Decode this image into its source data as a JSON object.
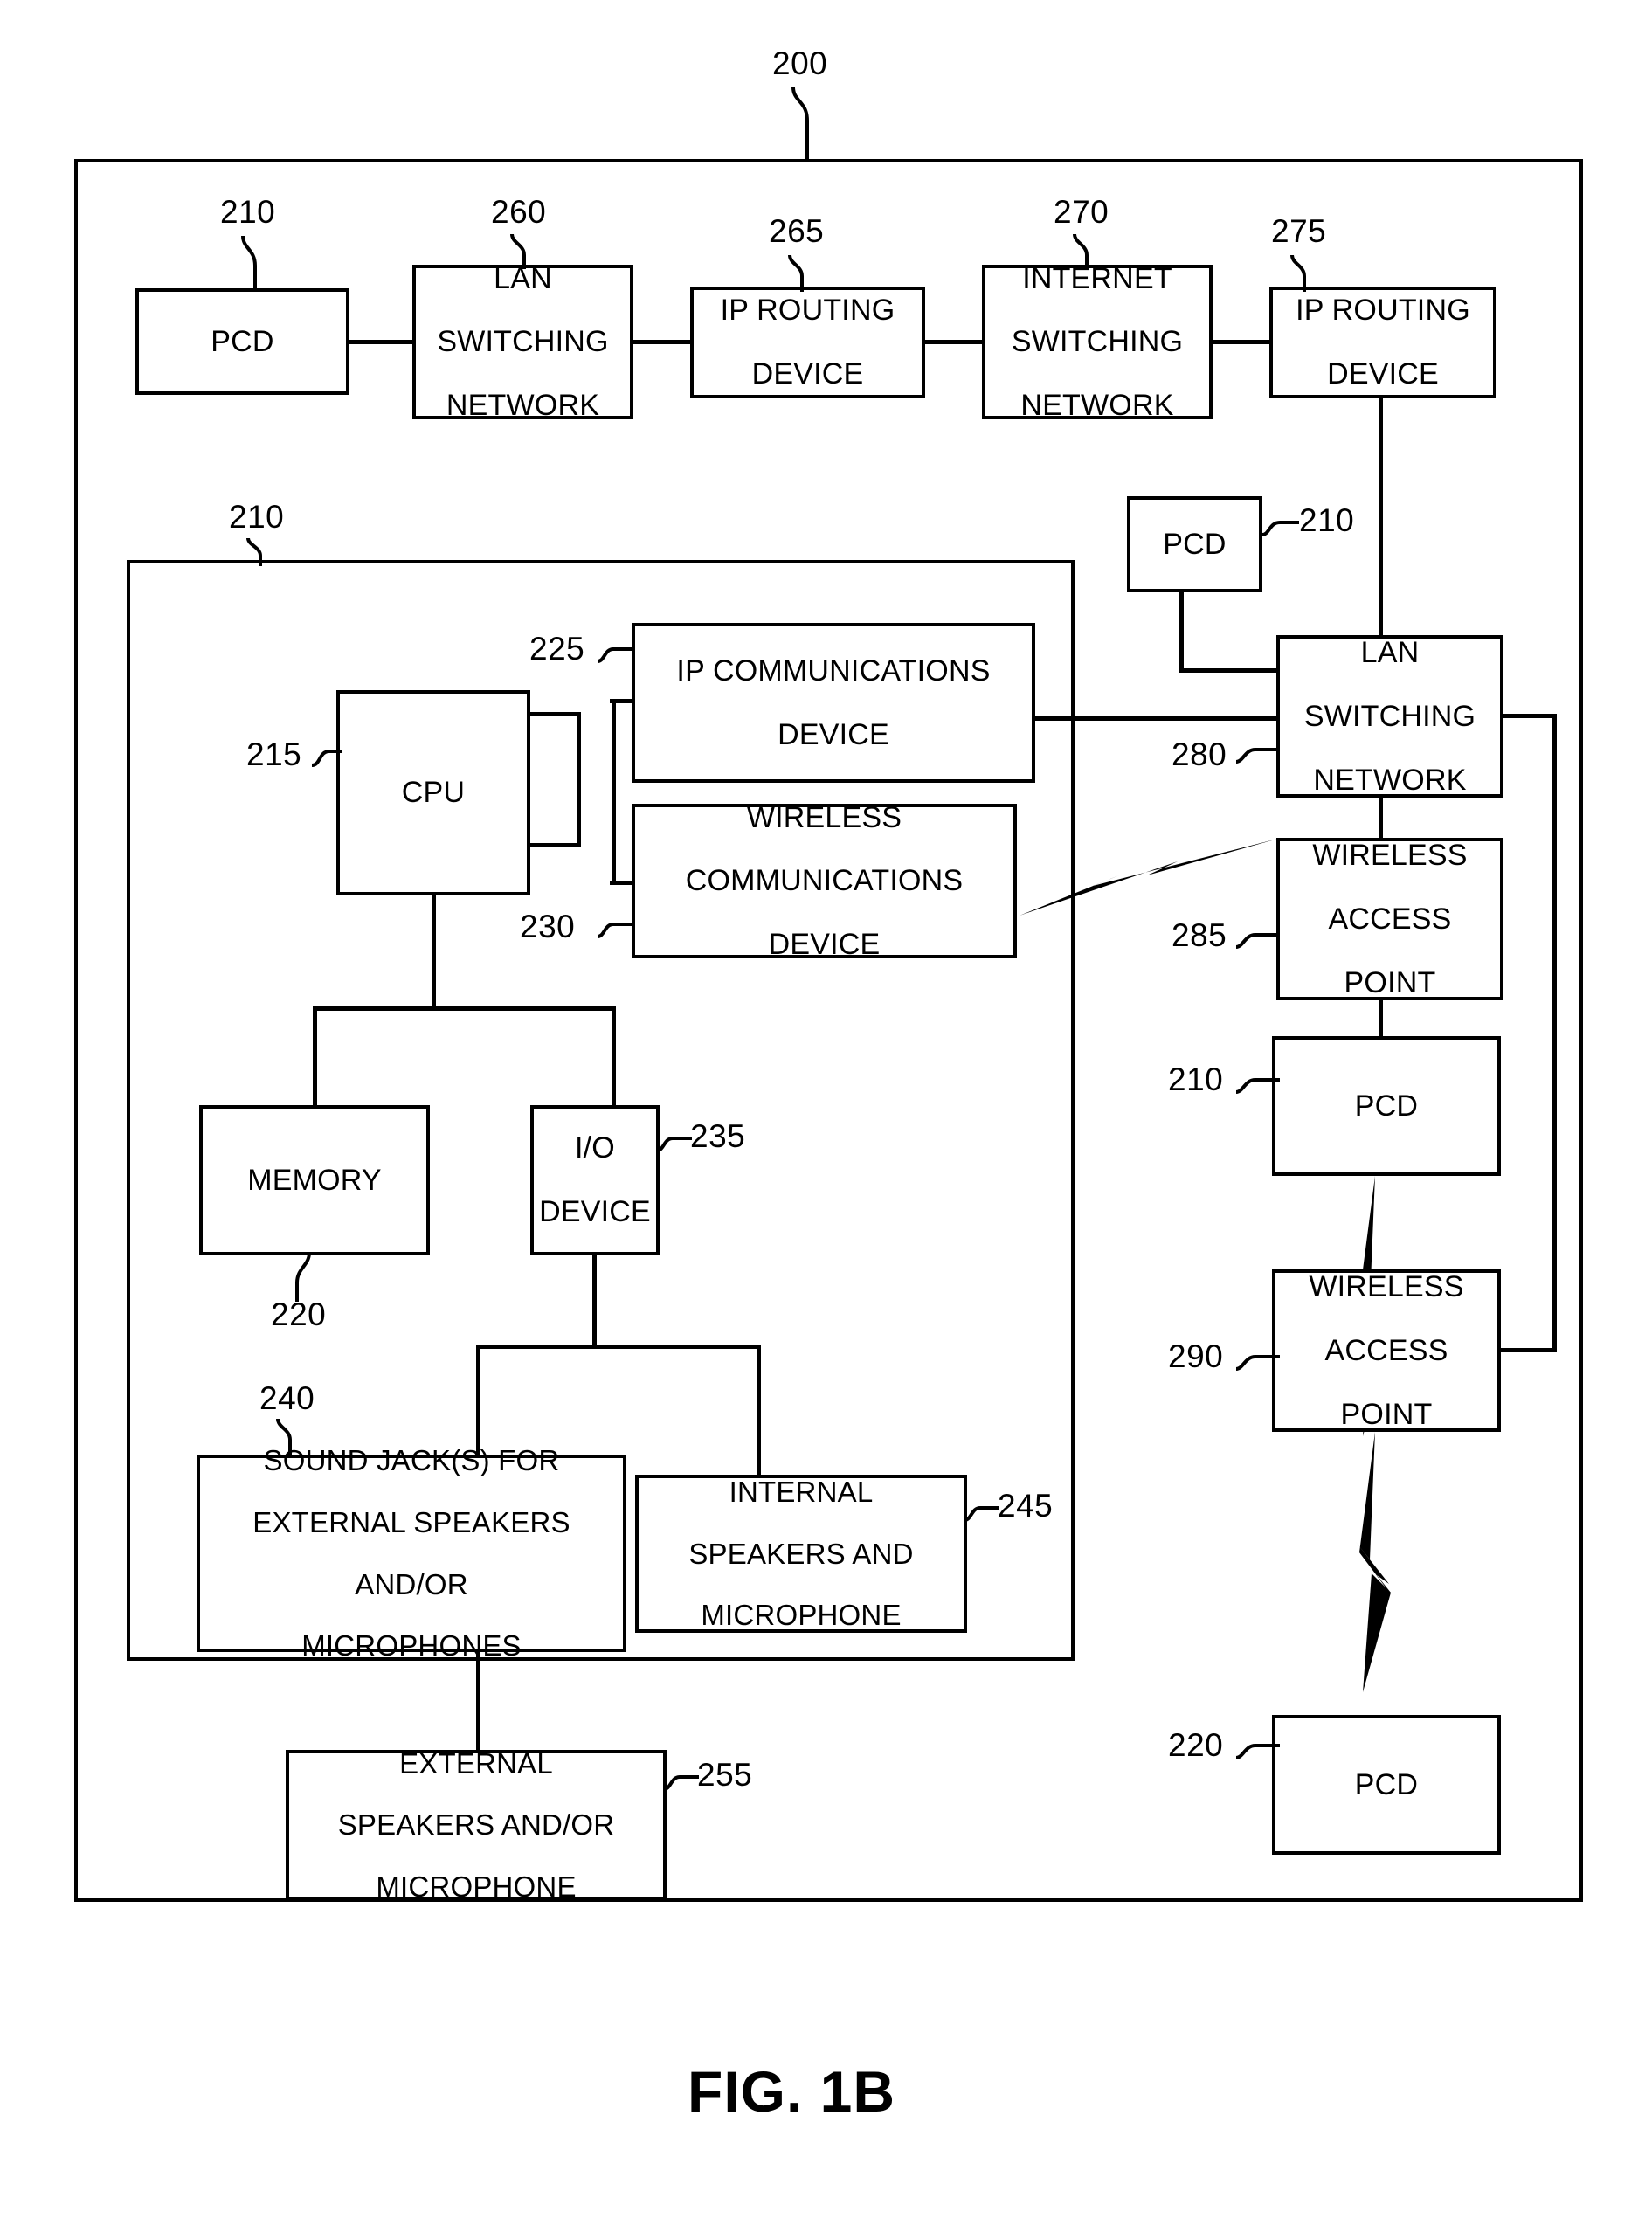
{
  "figure": {
    "caption": "FIG. 1B",
    "system_ref": "200"
  },
  "top_row": {
    "boxes": [
      {
        "ref": "210",
        "lines": [
          "PCD"
        ]
      },
      {
        "ref": "260",
        "lines": [
          "LAN",
          "SWITCHING",
          "NETWORK"
        ]
      },
      {
        "ref": "265",
        "lines": [
          "IP ROUTING",
          "DEVICE"
        ]
      },
      {
        "ref": "270",
        "lines": [
          "INTERNET",
          "SWITCHING",
          "NETWORK"
        ]
      },
      {
        "ref": "275",
        "lines": [
          "IP ROUTING",
          "DEVICE"
        ]
      }
    ]
  },
  "pcd_detail": {
    "ref": "210",
    "components": [
      {
        "ref": "215",
        "lines": [
          "CPU"
        ]
      },
      {
        "ref": "225",
        "lines": [
          "IP COMMUNICATIONS",
          "DEVICE"
        ]
      },
      {
        "ref": "230",
        "lines": [
          "WIRELESS",
          "COMMUNICATIONS",
          "DEVICE"
        ]
      },
      {
        "ref": "220",
        "lines": [
          "MEMORY"
        ]
      },
      {
        "ref": "235",
        "lines": [
          "I/O",
          "DEVICE"
        ]
      },
      {
        "ref": "240",
        "lines": [
          "SOUND JACK(S) FOR",
          "EXTERNAL SPEAKERS",
          "AND/OR",
          "MICROPHONES"
        ]
      },
      {
        "ref": "245",
        "lines": [
          "INTERNAL",
          "SPEAKERS AND",
          "MICROPHONE"
        ]
      }
    ],
    "external": {
      "ref": "255",
      "lines": [
        "EXTERNAL",
        "SPEAKERS AND/OR",
        "MICROPHONE"
      ]
    }
  },
  "right_column": {
    "boxes": [
      {
        "ref": "210",
        "lines": [
          "PCD"
        ]
      },
      {
        "ref": "280",
        "lines": [
          "LAN",
          "SWITCHING",
          "NETWORK"
        ]
      },
      {
        "ref": "285",
        "lines": [
          "WIRELESS",
          "ACCESS",
          "POINT"
        ]
      },
      {
        "ref": "210",
        "lines": [
          "PCD"
        ]
      },
      {
        "ref": "290",
        "lines": [
          "WIRELESS",
          "ACCESS",
          "POINT"
        ]
      },
      {
        "ref": "220",
        "lines": [
          "PCD"
        ]
      }
    ]
  },
  "colors": {
    "ink": "#000000",
    "paper": "#ffffff"
  }
}
